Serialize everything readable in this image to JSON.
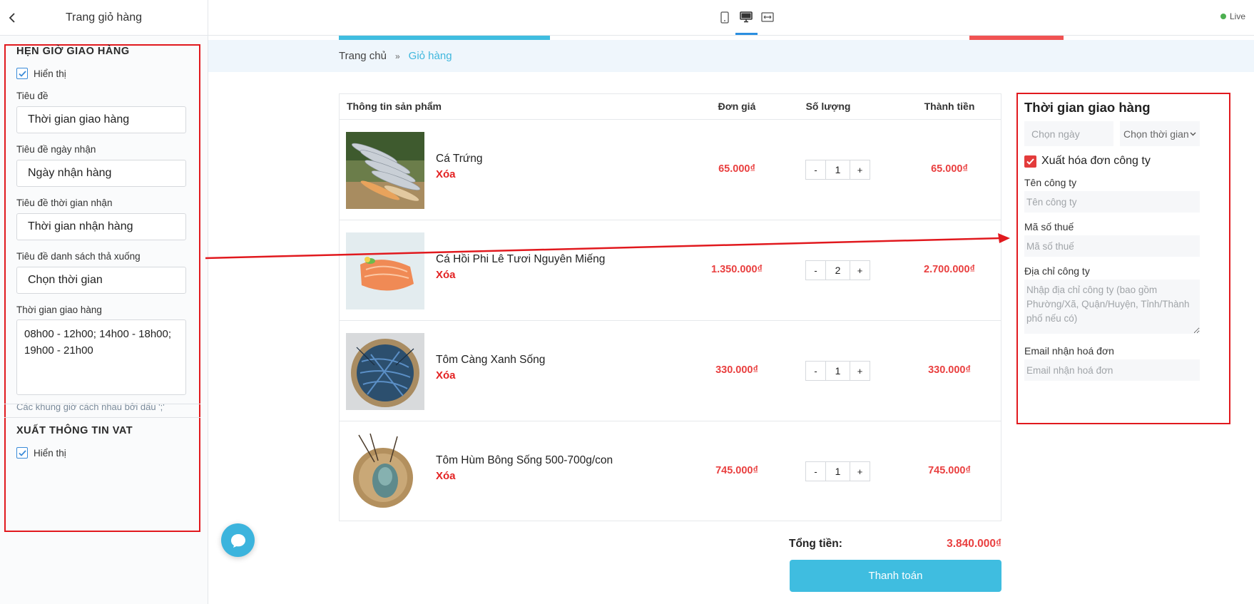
{
  "sidebar": {
    "title": "Trang giỏ hàng",
    "section_delivery": {
      "heading": "HẸN GIỜ GIAO HÀNG",
      "show_label": "Hiển thị",
      "title_label": "Tiêu đề",
      "title_value": "Thời gian giao hàng",
      "date_title_label": "Tiêu đề ngày nhận",
      "date_title_value": "Ngày nhận hàng",
      "time_title_label": "Tiêu đề thời gian nhận",
      "time_title_value": "Thời gian nhận hàng",
      "dropdown_title_label": "Tiêu đề danh sách thả xuống",
      "dropdown_title_value": "Chọn thời gian",
      "slots_label": "Thời gian giao hàng",
      "slots_value": "08h00 - 12h00; 14h00 - 18h00; 19h00 - 21h00",
      "slots_hint": "Các khung giờ cách nhau bởi dấu ';'"
    },
    "section_vat": {
      "heading": "XUẤT THÔNG TIN VAT",
      "show_label": "Hiển thị"
    }
  },
  "topbar": {
    "live_label": "Live"
  },
  "breadcrumb": {
    "home": "Trang chủ",
    "separator": "»",
    "current": "Giỏ hàng"
  },
  "cart": {
    "headers": {
      "product": "Thông tin sản phẩm",
      "unit_price": "Đơn giá",
      "quantity": "Số lượng",
      "subtotal": "Thành tiền"
    },
    "delete_label": "Xóa",
    "minus_label": "-",
    "plus_label": "+",
    "items": [
      {
        "name": "Cá Trứng",
        "price": "65.000₫",
        "qty": "1",
        "subtotal": "65.000₫"
      },
      {
        "name": "Cá Hồi Phi Lê Tươi Nguyên Miếng",
        "price": "1.350.000₫",
        "qty": "2",
        "subtotal": "2.700.000₫"
      },
      {
        "name": "Tôm Càng Xanh Sống",
        "price": "330.000₫",
        "qty": "1",
        "subtotal": "330.000₫"
      },
      {
        "name": "Tôm Hùm Bông Sống 500-700g/con",
        "price": "745.000₫",
        "qty": "1",
        "subtotal": "745.000₫"
      }
    ],
    "total_label": "Tổng tiền:",
    "total_value": "3.840.000₫",
    "checkout_label": "Thanh toán"
  },
  "delivery_panel": {
    "title": "Thời gian giao hàng",
    "date_placeholder": "Chọn ngày",
    "time_select": "Chọn thời gian",
    "vat_label": "Xuất hóa đơn công ty",
    "company_name_label": "Tên công ty",
    "company_name_placeholder": "Tên công ty",
    "tax_code_label": "Mã số thuế",
    "tax_code_placeholder": "Mã số thuế",
    "address_label": "Địa chỉ công ty",
    "address_placeholder": "Nhập địa chỉ công ty (bao gồm Phường/Xã, Quận/Huyện, Tỉnh/Thành phố nếu có)",
    "email_label": "Email nhận hoá đơn",
    "email_placeholder": "Email nhận hoá đơn"
  },
  "colors": {
    "accent_blue": "#3fbde0",
    "price_red": "#e94040",
    "annotation_red": "#e1191e",
    "live_green": "#4caf50"
  }
}
